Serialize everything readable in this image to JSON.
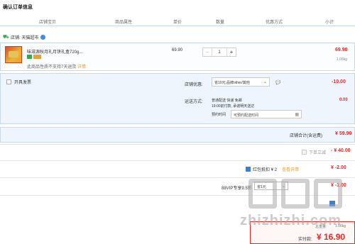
{
  "page": {
    "title": "确认订单信息"
  },
  "columns": [
    "店铺宝贝",
    "商品属性",
    "单价",
    "数量",
    "优惠方式",
    "小计"
  ],
  "shop": {
    "label": "店铺: 天猫超市"
  },
  "item": {
    "name": "味滋源秋月礼月饼礼盒720g...",
    "note": "此商品性质不支持7天退货",
    "note_link": "详情",
    "unit_price": "69.90",
    "quantity": "1",
    "minus": "−",
    "plus": "+",
    "subtotal": "69.90",
    "weight": "1.06kg"
  },
  "invoice": {
    "label": "开具发票"
  },
  "discount": {
    "label": "店铺优惠:",
    "selected": "省10元:品牌other/其他",
    "amount": "-10.00"
  },
  "delivery": {
    "label": "运送方式:",
    "lines": [
      "普通配送 快递 免邮",
      "19:00前付款, 承诺明天送达"
    ],
    "time_label": "预约时间",
    "time_value": "可预约配送时间",
    "fee": "0.00"
  },
  "shop_total": {
    "label": "店铺合计(含运费)",
    "value": "¥ 59.90"
  },
  "rows": {
    "instant": {
      "label": "下单立减",
      "value": "- ¥ 40.00"
    },
    "redpacket": {
      "label": "红包抵扣 ¥ 2",
      "link": "查看详情",
      "value": "¥ -2.00"
    },
    "vip": {
      "label": "88VIP专享9.5折",
      "selected": "省1元",
      "value": "¥ -1.00"
    }
  },
  "total": {
    "weight_label": "总重量:",
    "weight": "1.06kg",
    "pay_label": "实付款:",
    "pay_value": "¥ 16.90"
  },
  "watermark": {
    "text": "zhizhizhi.com"
  }
}
